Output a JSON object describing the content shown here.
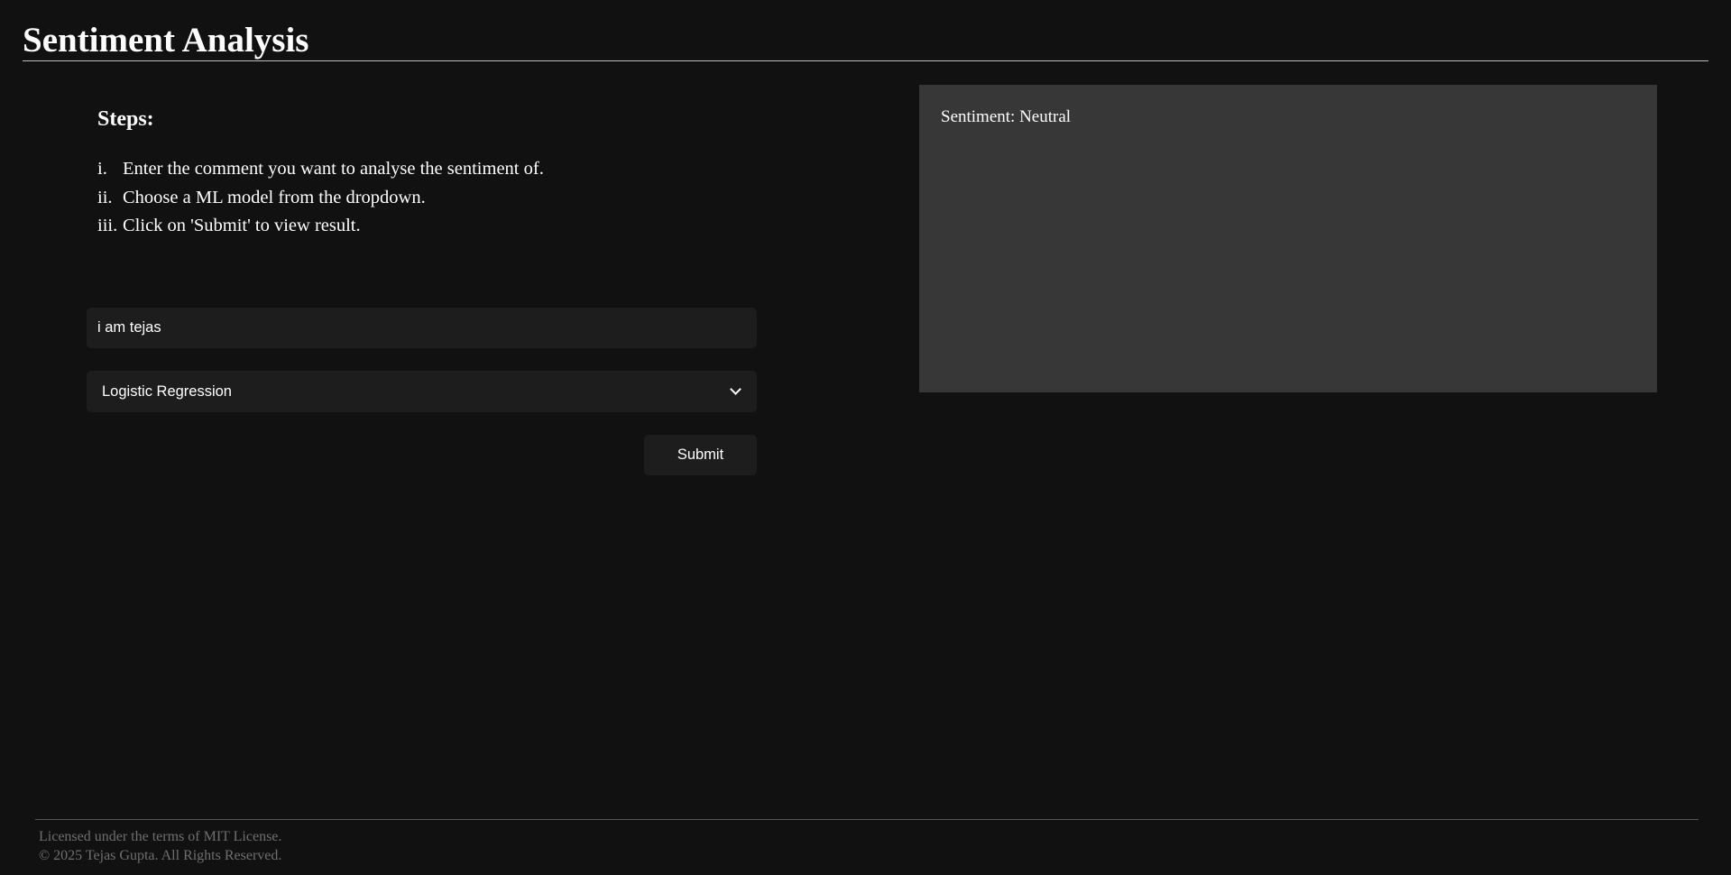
{
  "header": {
    "title": "Sentiment Analysis"
  },
  "steps": {
    "heading": "Steps:",
    "items": [
      {
        "num": "i.",
        "text": "Enter the comment you want to analyse the sentiment of."
      },
      {
        "num": "ii.",
        "text": "Choose a ML model from the dropdown."
      },
      {
        "num": "iii.",
        "text": "Click on 'Submit' to view result."
      }
    ]
  },
  "form": {
    "comment_value": "i am tejas",
    "model_selected": "Logistic Regression",
    "submit_label": "Submit"
  },
  "result": {
    "text": "Sentiment: Neutral"
  },
  "footer": {
    "license": "Licensed under the terms of MIT License.",
    "copyright": "© 2025 Tejas Gupta. All Rights Reserved."
  },
  "colors": {
    "background": "#111111",
    "panel": "#373737",
    "control": "#1d1d1d",
    "text": "#ffffff",
    "footer_text": "#6f6f6f"
  },
  "icons": {
    "dropdown": "chevron-down-icon"
  }
}
